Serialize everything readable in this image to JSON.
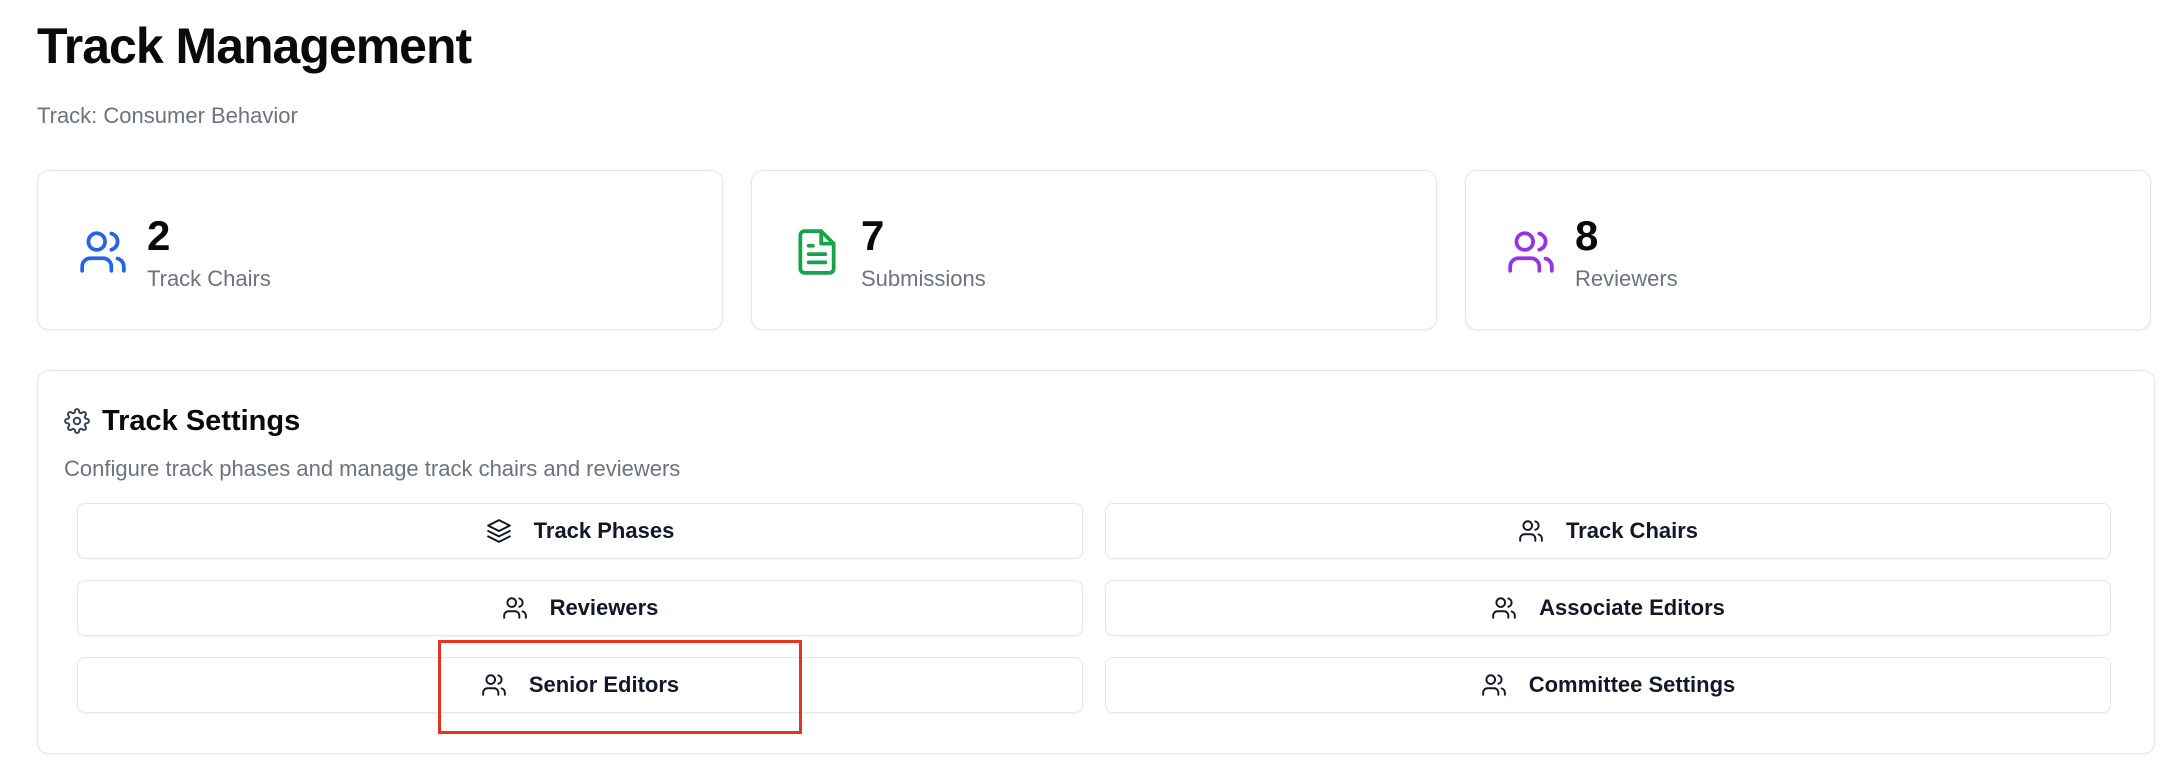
{
  "header": {
    "title": "Track Management",
    "subtitle": "Track: Consumer Behavior"
  },
  "stats": [
    {
      "value": "2",
      "label": "Track Chairs",
      "icon": "users-icon",
      "color": "#2563eb"
    },
    {
      "value": "7",
      "label": "Submissions",
      "icon": "file-text-icon",
      "color": "#16a34a"
    },
    {
      "value": "8",
      "label": "Reviewers",
      "icon": "users-icon",
      "color": "#9333ea"
    }
  ],
  "settings": {
    "title": "Track Settings",
    "title_icon": "gear-icon",
    "description": "Configure track phases and manage track chairs and reviewers",
    "buttons": [
      {
        "label": "Track Phases",
        "icon": "layers-icon"
      },
      {
        "label": "Track Chairs",
        "icon": "users-icon"
      },
      {
        "label": "Reviewers",
        "icon": "users-icon"
      },
      {
        "label": "Associate Editors",
        "icon": "users-icon"
      },
      {
        "label": "Senior Editors",
        "icon": "users-icon"
      },
      {
        "label": "Committee Settings",
        "icon": "users-icon"
      }
    ]
  },
  "annotation": {
    "highlight_color": "#e8321e",
    "highlighted_item": "Senior Editors"
  }
}
